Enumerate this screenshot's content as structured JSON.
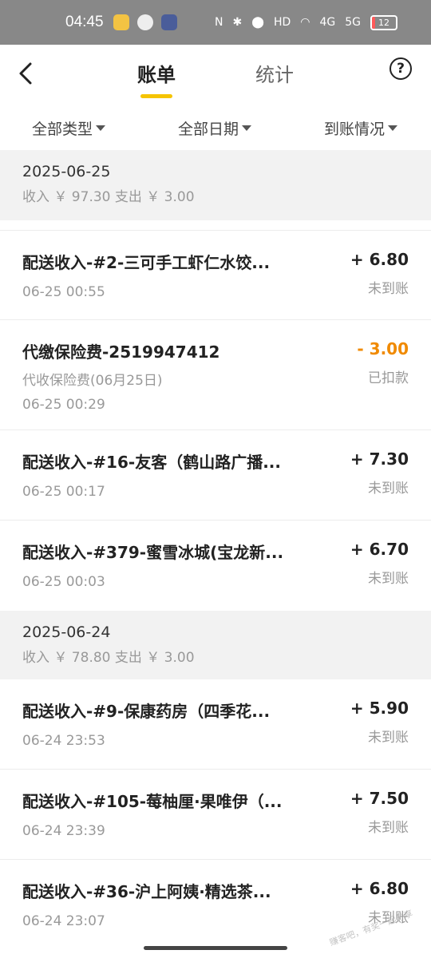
{
  "status_bar": {
    "time": "04:45",
    "network_4g": "4G",
    "network_5g": "5G",
    "battery": "12",
    "battery_level": 0.12,
    "hd_label": "HD"
  },
  "header": {
    "tabs": [
      {
        "label": "账单",
        "active": true
      },
      {
        "label": "统计",
        "active": false
      }
    ],
    "help_symbol": "?"
  },
  "filters": [
    {
      "label": "全部类型"
    },
    {
      "label": "全部日期"
    },
    {
      "label": "到账情况"
    }
  ],
  "colors": {
    "accent": "#f5c400",
    "income": "#222222",
    "expense": "#f08a00"
  },
  "days": [
    {
      "date": "2025-06-25",
      "summary": "收入 ￥ 97.30  支出 ￥ 3.00",
      "items": [
        {
          "title": "配送收入-#2-三可手工虾仁水饺...",
          "time": "06-25 00:55",
          "amount": "+ 6.80",
          "status": "未到账"
        },
        {
          "title": "代缴保险费-2519947412",
          "subtitle": "代收保险费(06月25日)",
          "time": "06-25 00:29",
          "amount": "- 3.00",
          "status": "已扣款",
          "expense": true
        },
        {
          "title": "配送收入-#16-友客（鹤山路广播...",
          "time": "06-25 00:17",
          "amount": "+ 7.30",
          "status": "未到账"
        },
        {
          "title": "配送收入-#379-蜜雪冰城(宝龙新...",
          "time": "06-25 00:03",
          "amount": "+ 6.70",
          "status": "未到账"
        }
      ]
    },
    {
      "date": "2025-06-24",
      "summary": "收入 ￥ 78.80  支出 ￥ 3.00",
      "items": [
        {
          "title": "配送收入-#9-保康药房（四季花...",
          "time": "06-24 23:53",
          "amount": "+ 5.90",
          "status": "未到账"
        },
        {
          "title": "配送收入-#105-莓柚厘·果唯伊（...",
          "time": "06-24 23:39",
          "amount": "+ 7.50",
          "status": "未到账"
        },
        {
          "title": "配送收入-#36-沪上阿姨·精选茶...",
          "time": "06-24 23:07",
          "amount": "+ 6.80",
          "status": "未到账"
        }
      ]
    }
  ],
  "watermark": "赚客吧，有奖一起分享"
}
